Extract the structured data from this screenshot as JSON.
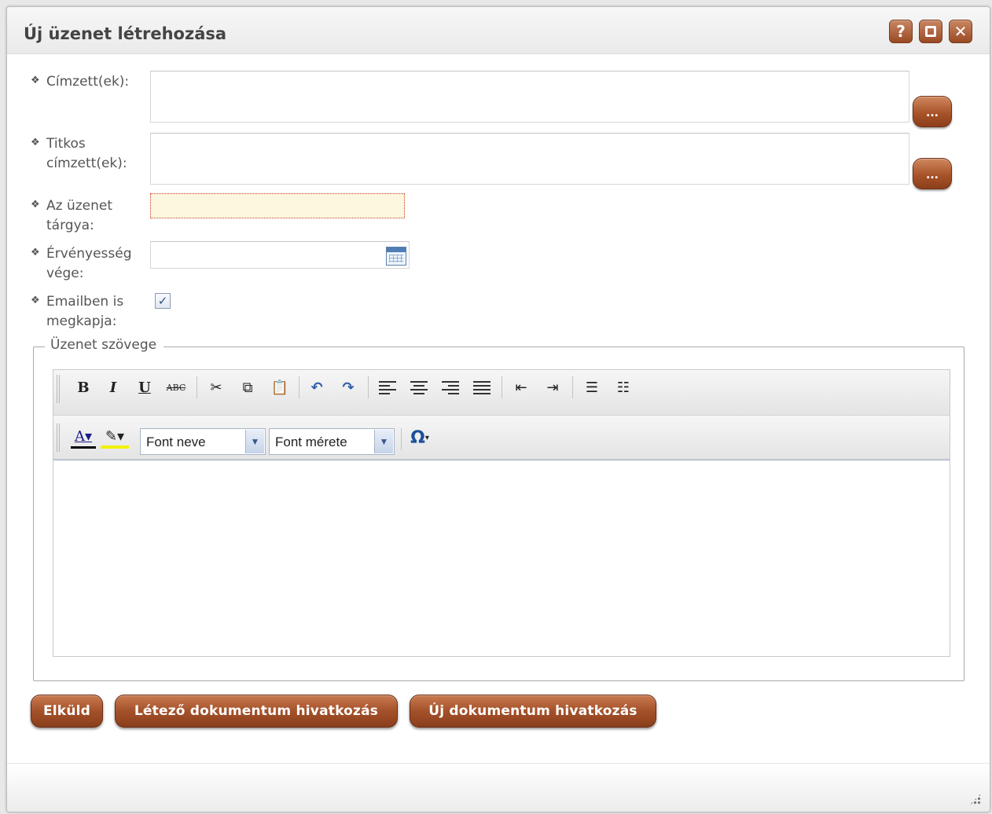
{
  "window": {
    "title": "Új üzenet létrehozása",
    "help_label": "?",
    "close_label": "✕"
  },
  "form": {
    "recipients_label": "Címzett(ek):",
    "bcc_label": "Titkos címzett(ek):",
    "subject_label": "Az üzenet tárgya:",
    "expiry_label": "Érvényesség vége:",
    "email_label": "Emailben is megkapja:",
    "browse_label": "...",
    "recipients_value": "",
    "bcc_value": "",
    "subject_value": "",
    "expiry_value": "",
    "email_checked": true
  },
  "message": {
    "legend": "Üzenet szövege",
    "font_name_placeholder": "Font neve",
    "font_size_placeholder": "Font mérete",
    "toolbar": {
      "bold": "B",
      "italic": "I",
      "underline": "U",
      "strike": "ABC",
      "special_char": "Ω"
    }
  },
  "actions": {
    "send": "Elküld",
    "existing_doc": "Létező dokumentum hivatkozás",
    "new_doc": "Új dokumentum hivatkozás"
  },
  "colors": {
    "accent": "#a4512a",
    "subject_bg": "#fdf7df",
    "subject_border": "#c23b22"
  }
}
